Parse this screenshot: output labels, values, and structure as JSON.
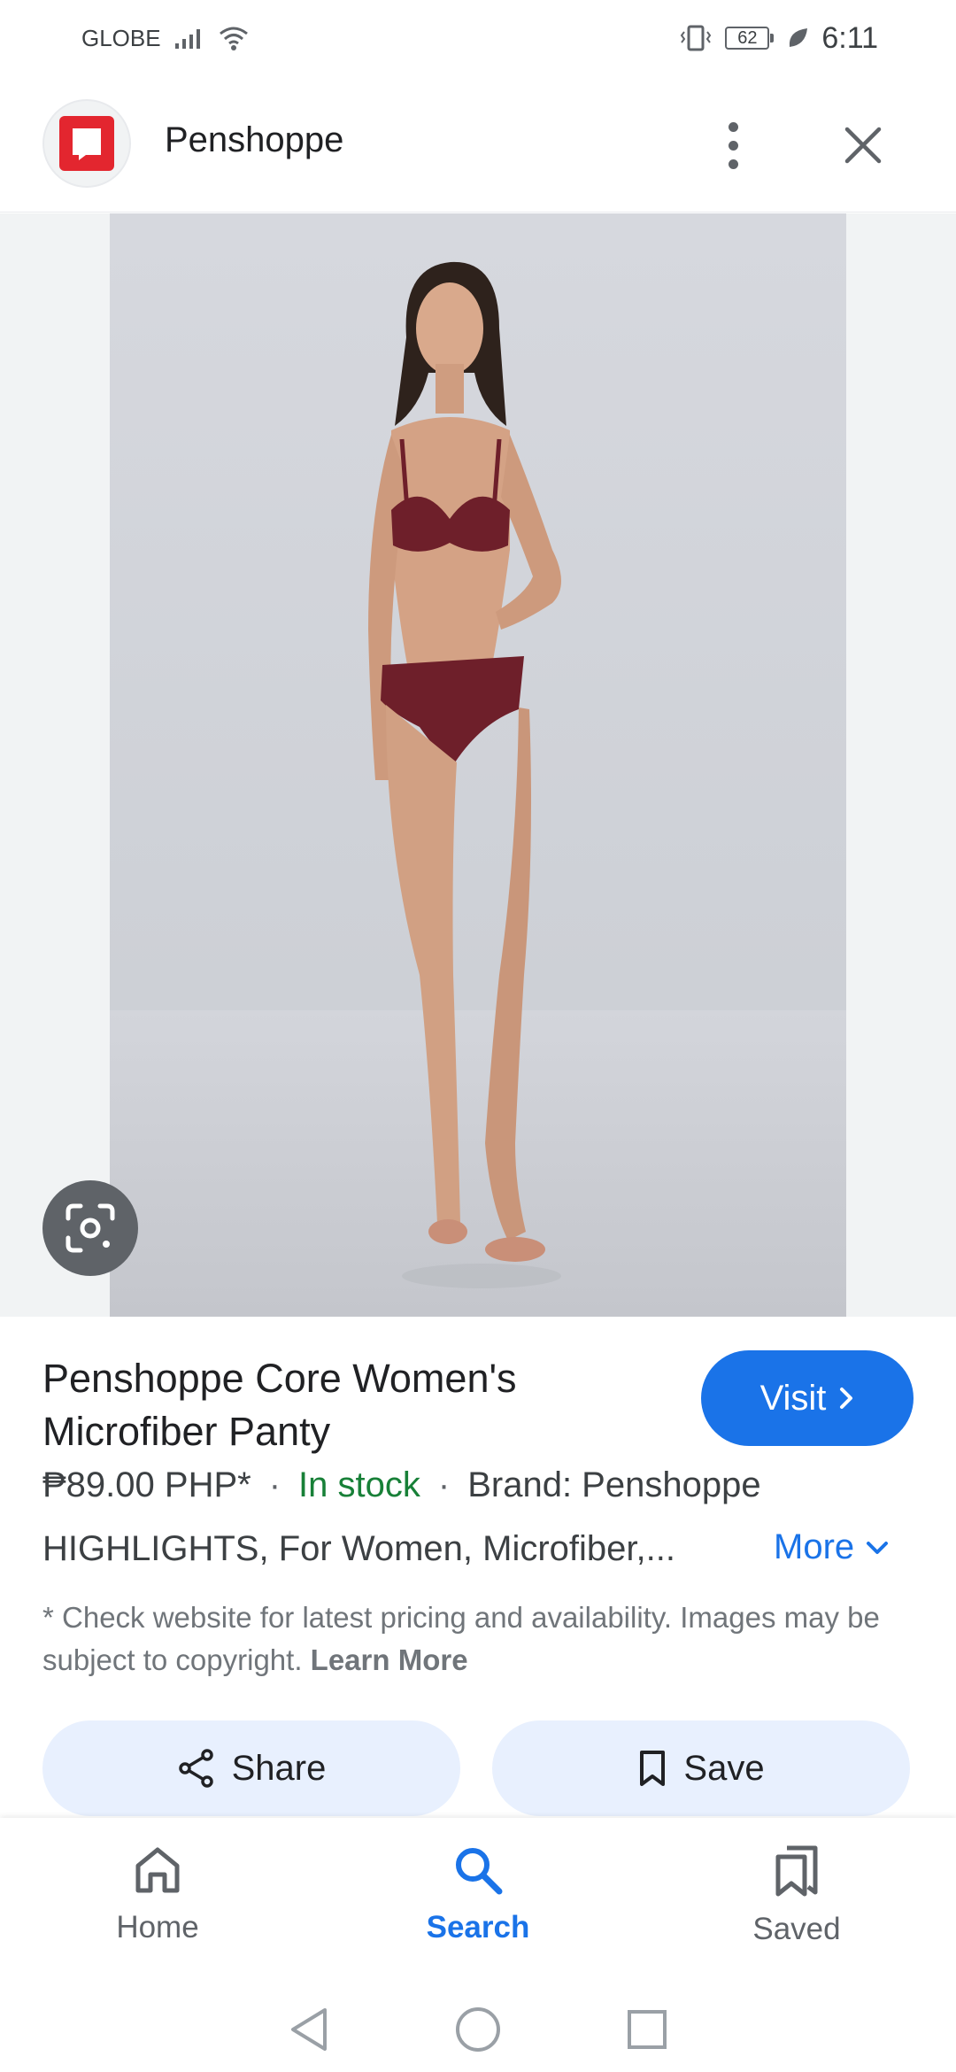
{
  "status_bar": {
    "carrier": "GLOBE",
    "battery": "62",
    "time": "6:11"
  },
  "header": {
    "site_name": "Penshoppe",
    "logo_color": "#e3262f"
  },
  "product": {
    "title": "Penshoppe Core Women's Microfiber Panty",
    "price": "₱89.00 PHP*",
    "separator": "·",
    "stock": "In stock",
    "brand": "Brand: Penshoppe",
    "highlights": "HIGHLIGHTS, For Women, Microfiber,...",
    "more_label": "More",
    "disclaimer": "* Check website for latest pricing and availability. Images may be subject to copyright.",
    "learn_more": "Learn More",
    "visit_label": "Visit"
  },
  "actions": {
    "share_label": "Share",
    "save_label": "Save"
  },
  "bottom_nav": {
    "items": [
      {
        "label": "Home",
        "icon": "home-icon"
      },
      {
        "label": "Search",
        "icon": "search-icon",
        "active": true
      },
      {
        "label": "Saved",
        "icon": "saved-icon"
      }
    ]
  },
  "colors": {
    "accent": "#1a73e8",
    "in_stock": "#188038",
    "chip_bg": "#e8f0fe",
    "garment": "#6e1f2a"
  }
}
